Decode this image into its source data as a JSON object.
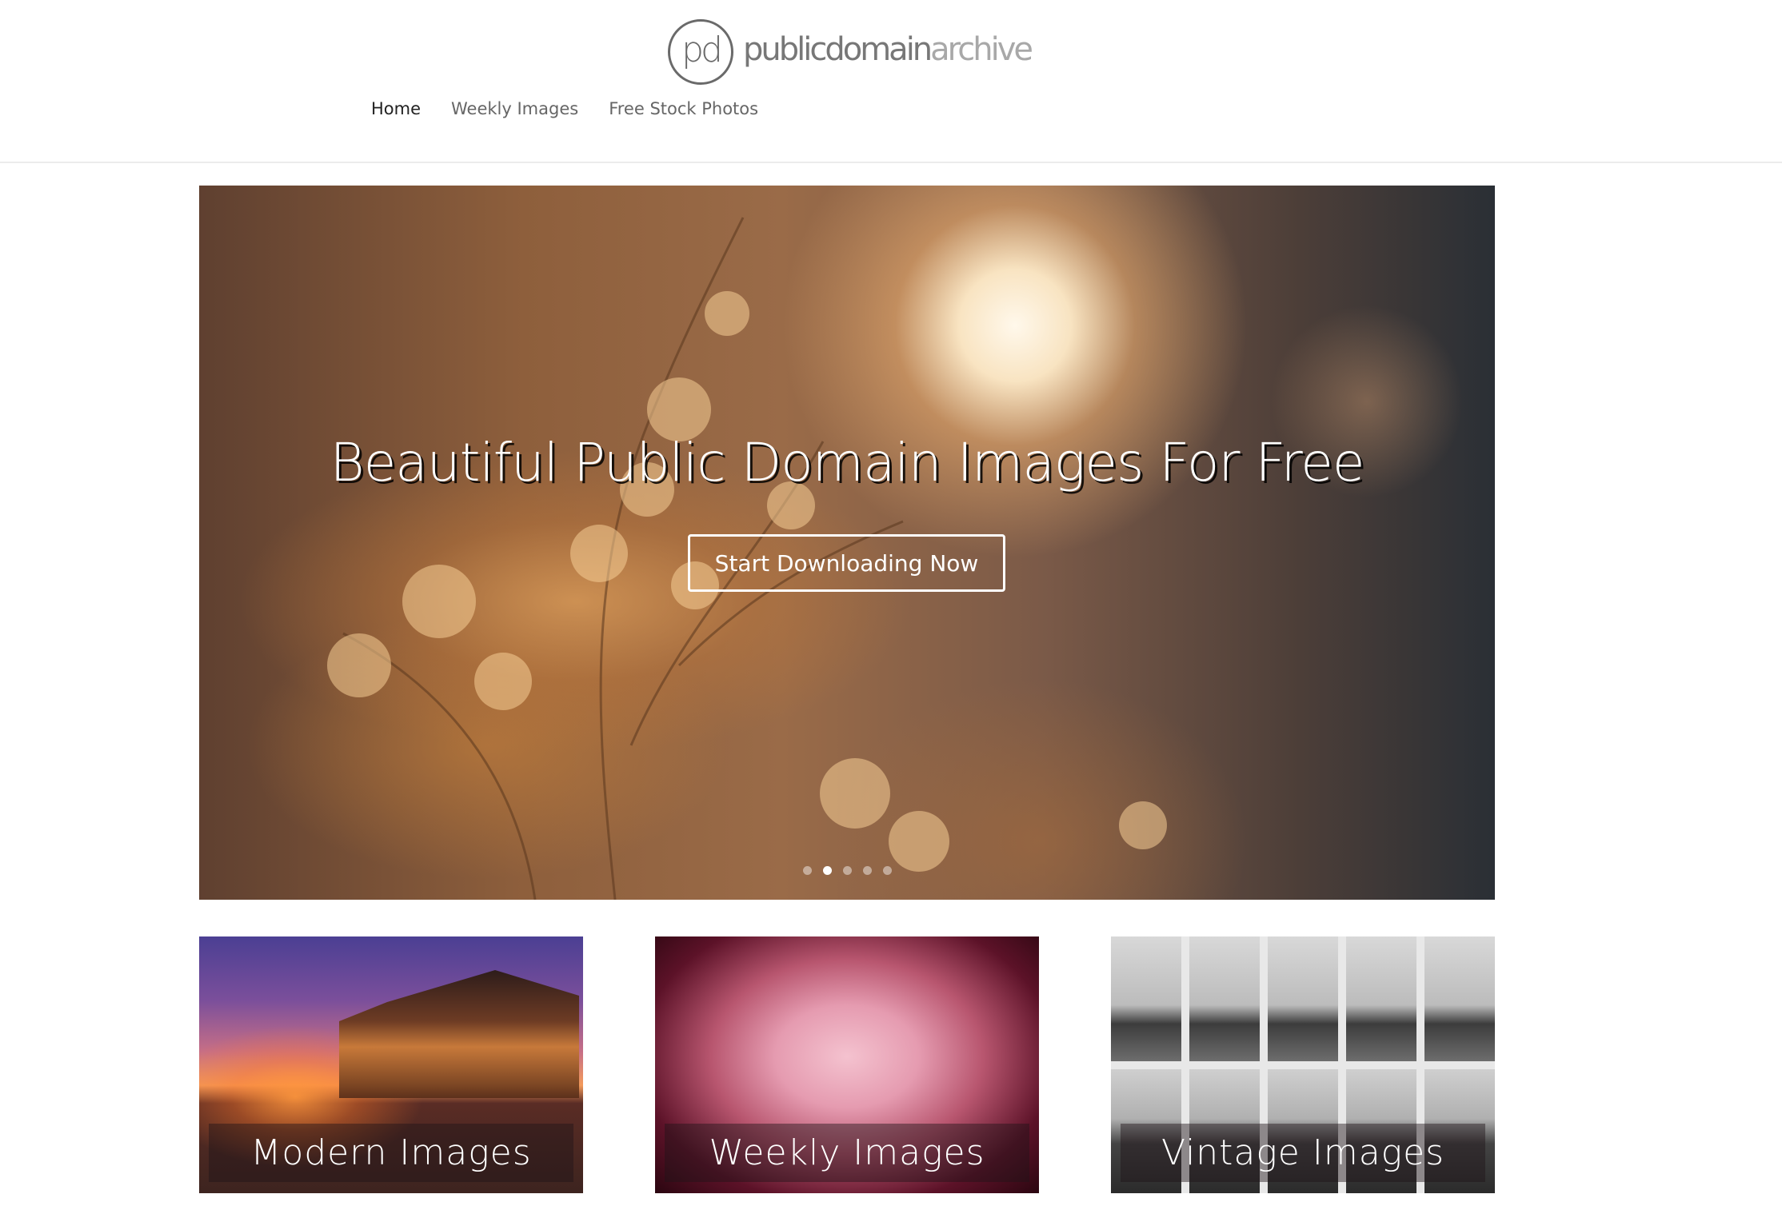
{
  "header": {
    "logo": {
      "mark": "pd",
      "text_main": "publicdomain",
      "text_light": "archive"
    },
    "nav": [
      {
        "label": "Home",
        "active": true
      },
      {
        "label": "Weekly Images",
        "active": false
      },
      {
        "label": "Free Stock Photos",
        "active": false
      }
    ]
  },
  "hero": {
    "title": "Beautiful Public Domain Images For Free",
    "button_label": "Start Downloading Now",
    "slides_count": 5,
    "active_slide": 2
  },
  "tiles": [
    {
      "label": "Modern Images"
    },
    {
      "label": "Weekly Images"
    },
    {
      "label": "Vintage Images"
    }
  ]
}
